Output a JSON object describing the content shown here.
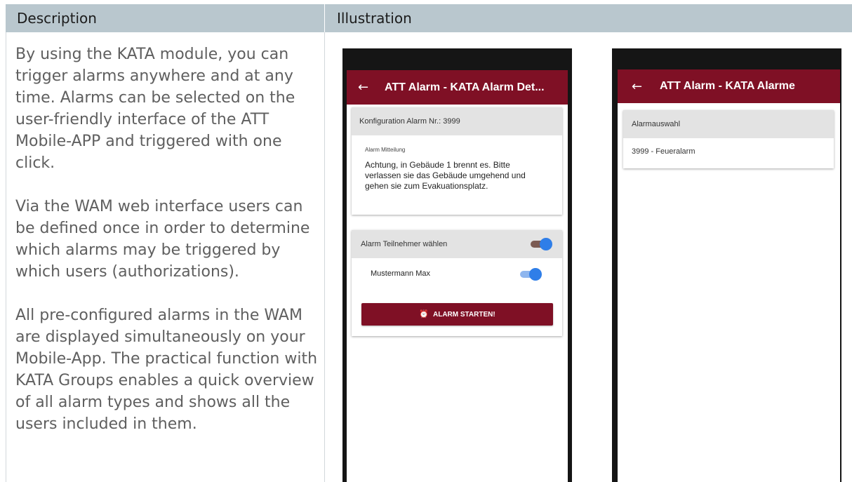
{
  "table": {
    "headers": [
      "Description",
      "Illustration"
    ],
    "paragraphs": [
      "By using the KATA module, you can trigger alarms anywhere and at any time. Alarms can be selected on the user-friendly interface of the ATT Mobile-APP and triggered with one click.",
      "Via the WAM web interface users can be defined once in order to determine which alarms may be triggered by which users (authorizations).",
      "All pre-configured alarms in the WAM are displayed simultaneously on your Mobile-App. The practical function with KATA Groups enables a quick overview of all alarm types and shows all the users included in them."
    ]
  },
  "colors": {
    "header_bg": "#b9c7ce",
    "appbar": "#7f1025",
    "toggle_on": "#2f7ee8"
  },
  "phone1": {
    "back_icon": "←",
    "title": "ATT Alarm - KATA Alarm Det...",
    "config_header": "Konfiguration Alarm Nr.: 3999",
    "message_label": "Alarm Mitteilung",
    "message_text": "Achtung, in Gebäude 1 brennt es. Bitte verlassen sie das Gebäude umgehend und gehen sie zum Evakuationsplatz.",
    "participants_header": "Alarm Teilnehmer wählen",
    "participants_toggle_on": true,
    "member_name": "Mustermann Max",
    "member_toggle_on": true,
    "start_button_icon": "alarm-clock-icon",
    "start_button_label": "ALARM STARTEN!"
  },
  "phone2": {
    "back_icon": "←",
    "title": "ATT Alarm - KATA Alarme",
    "selection_header": "Alarmauswahl",
    "alarm_item": "3999 - Feueralarm"
  }
}
